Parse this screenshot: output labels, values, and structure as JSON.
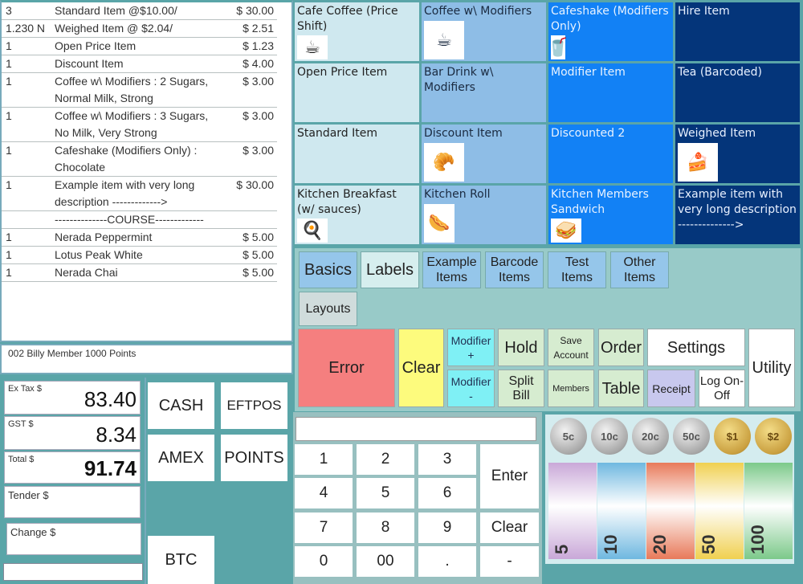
{
  "order": {
    "rows": [
      {
        "qty": "3",
        "desc": "Standard Item @$10.00/",
        "price": "$ 30.00"
      },
      {
        "qty": "1.230  N",
        "desc": "Weighed Item @ $2.04/",
        "price": "$ 2.51"
      },
      {
        "qty": "1",
        "desc": "Open Price Item",
        "price": "$ 1.23"
      },
      {
        "qty": "1",
        "desc": "Discount Item",
        "price": "$ 4.00"
      },
      {
        "qty": "1",
        "desc": "Coffee w\\ Modifiers : 2 Sugars, Normal Milk, Strong",
        "price": "$ 3.00"
      },
      {
        "qty": "1",
        "desc": "Coffee w\\ Modifiers : 3 Sugars, No Milk, Very Strong",
        "price": "$ 3.00"
      },
      {
        "qty": "1",
        "desc": "Cafeshake (Modifiers Only) : Chocolate",
        "price": "$ 3.00"
      },
      {
        "qty": "1",
        "desc": "Example item with very long description ------------->",
        "price": "$ 30.00"
      },
      {
        "qty": "",
        "desc": "--------------COURSE-------------",
        "price": ""
      },
      {
        "qty": "1",
        "desc": "Nerada Peppermint",
        "price": "$ 5.00"
      },
      {
        "qty": "1",
        "desc": "Lotus Peak White",
        "price": "$ 5.00"
      },
      {
        "qty": "1",
        "desc": "Nerada Chai",
        "price": "$ 5.00"
      }
    ]
  },
  "member": {
    "info": "002 Billy Member  1000 Points"
  },
  "totals": {
    "ex_tax_label": "Ex Tax $",
    "ex_tax_value": "83.40",
    "gst_label": "GST $",
    "gst_value": "8.34",
    "total_label": "Total $",
    "total_value": "91.74",
    "tender_label": "Tender $",
    "tender_value": "",
    "change_label": "Change $",
    "change_value": ""
  },
  "payments": {
    "cash": "CASH",
    "eftpos": "EFTPOS",
    "amex": "AMEX",
    "points": "POINTS",
    "btc": "BTC"
  },
  "products": [
    {
      "name": "Cafe Coffee (Price Shift)",
      "icon": "coffee-cup-icon",
      "glyph": "☕"
    },
    {
      "name": "Coffee w\\ Modifiers",
      "icon": "cappuccino-icon",
      "glyph": "☕"
    },
    {
      "name": "Cafeshake (Modifiers Only)",
      "icon": "milkshake-icon",
      "glyph": "🥤"
    },
    {
      "name": "Hire Item",
      "icon": "",
      "glyph": ""
    },
    {
      "name": "Open Price Item",
      "icon": "",
      "glyph": ""
    },
    {
      "name": "Bar Drink w\\ Modifiers",
      "icon": "",
      "glyph": ""
    },
    {
      "name": "Modifier Item",
      "icon": "",
      "glyph": ""
    },
    {
      "name": "Tea (Barcoded)",
      "icon": "",
      "glyph": ""
    },
    {
      "name": "Standard Item",
      "icon": "",
      "glyph": ""
    },
    {
      "name": "Discount Item",
      "icon": "pastry-icon",
      "glyph": "🥐"
    },
    {
      "name": "Discounted 2",
      "icon": "",
      "glyph": ""
    },
    {
      "name": "Weighed Item",
      "icon": "cake-slice-icon",
      "glyph": "🍰"
    },
    {
      "name": "Kitchen Breakfast (w/ sauces)",
      "icon": "breakfast-icon",
      "glyph": "🍳"
    },
    {
      "name": "Kitchen Roll",
      "icon": "hotdog-roll-icon",
      "glyph": "🌭"
    },
    {
      "name": "Kitchen Members Sandwich",
      "icon": "sandwich-icon",
      "glyph": "🥪"
    },
    {
      "name": "Example item with very long description -------------->",
      "icon": "",
      "glyph": ""
    }
  ],
  "categories": [
    {
      "label": "Basics"
    },
    {
      "label": "Labels"
    },
    {
      "label": "Example Items"
    },
    {
      "label": "Barcode Items"
    },
    {
      "label": "Test Items"
    },
    {
      "label": "Other Items"
    },
    {
      "label": "Layouts"
    }
  ],
  "functions": {
    "error": "Error",
    "clear": "Clear",
    "modifier_plus": "Modifier +",
    "modifier_minus": "Modifier -",
    "hold": "Hold",
    "split_bill": "Split Bill",
    "save_account": "Save Account",
    "members": "Members",
    "order": "Order",
    "table": "Table",
    "settings": "Settings",
    "receipt": "Receipt",
    "log_on_off": "Log On-Off",
    "utility": "Utility"
  },
  "keypad": {
    "input_value": "",
    "keys": [
      "1",
      "2",
      "3",
      "4",
      "5",
      "6",
      "7",
      "8",
      "9",
      "0",
      "00",
      ".",
      "-"
    ],
    "enter": "Enter",
    "clear": "Clear"
  },
  "cash": {
    "coins": [
      {
        "label": "5c",
        "type": "silver"
      },
      {
        "label": "10c",
        "type": "silver"
      },
      {
        "label": "20c",
        "type": "silver"
      },
      {
        "label": "50c",
        "type": "silver"
      },
      {
        "label": "$1",
        "type": "gold"
      },
      {
        "label": "$2",
        "type": "gold"
      }
    ],
    "notes": [
      {
        "label": "5",
        "color": "#c9a8d8"
      },
      {
        "label": "10",
        "color": "#6fb8e0"
      },
      {
        "label": "20",
        "color": "#e87a5a"
      },
      {
        "label": "50",
        "color": "#f0d050"
      },
      {
        "label": "100",
        "color": "#7cc98a"
      }
    ]
  },
  "colors": {
    "background": "#5aa5a8",
    "error": "#f57f7f",
    "clear": "#fdfb7d",
    "modifier": "#7ff0f5",
    "function_green": "#d6ecd0",
    "receipt": "#c8c8ee"
  }
}
